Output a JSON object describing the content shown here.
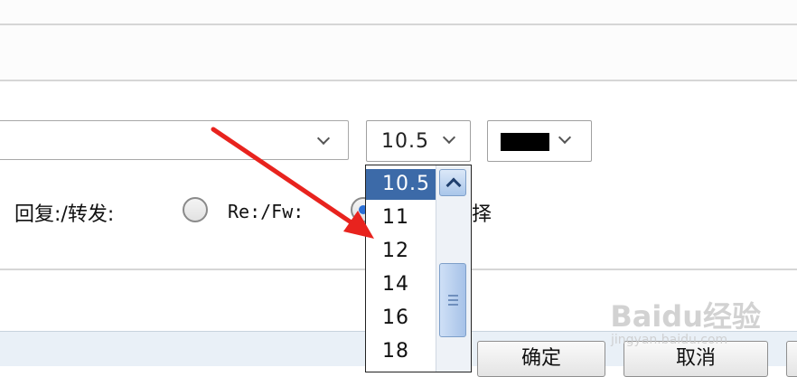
{
  "font_size": {
    "selected": "10.5",
    "options": [
      "10.5",
      "11",
      "12",
      "14",
      "16",
      "18"
    ]
  },
  "font_color": {
    "value": "#000000"
  },
  "reply": {
    "label": "回复:/转发:",
    "option_prefix": "Re:/Fw:",
    "option_custom_partial": "择"
  },
  "buttons": {
    "ok": "确定",
    "cancel": "取消"
  },
  "watermark": {
    "brand": "Baidu经验",
    "url": "jingyan.baidu.com"
  }
}
